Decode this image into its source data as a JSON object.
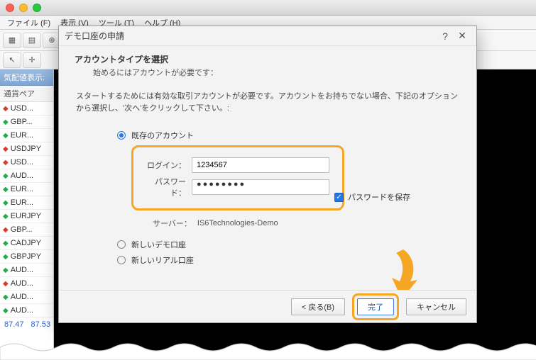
{
  "menus": {
    "file": "ファイル (F)",
    "view": "表示 (V)",
    "tools": "ツール (T)",
    "help": "ヘルプ (H)"
  },
  "sidebar": {
    "header": "気配値表示:",
    "col": "通貨ペア",
    "items": [
      {
        "dir": "dn",
        "sym": "USD..."
      },
      {
        "dir": "up",
        "sym": "GBP..."
      },
      {
        "dir": "up",
        "sym": "EUR..."
      },
      {
        "dir": "dn",
        "sym": "USDJPY"
      },
      {
        "dir": "dn",
        "sym": "USD..."
      },
      {
        "dir": "up",
        "sym": "AUD..."
      },
      {
        "dir": "up",
        "sym": "EUR..."
      },
      {
        "dir": "up",
        "sym": "EUR..."
      },
      {
        "dir": "up",
        "sym": "EURJPY"
      },
      {
        "dir": "dn",
        "sym": "GBP..."
      },
      {
        "dir": "up",
        "sym": "CADJPY"
      },
      {
        "dir": "up",
        "sym": "GBPJPY"
      },
      {
        "dir": "up",
        "sym": "AUD..."
      },
      {
        "dir": "dn",
        "sym": "AUD..."
      },
      {
        "dir": "up",
        "sym": "AUD..."
      },
      {
        "dir": "up",
        "sym": "AUD..."
      }
    ],
    "price1": "87.47",
    "price2": "87.53"
  },
  "dialog": {
    "title": "デモ口座の申請",
    "heading": "アカウントタイプを選択",
    "sub": "始めるにはアカウントが必要です：",
    "desc": "スタートするためには有効な取引アカウントが必要です。アカウントをお持ちでない場合、下記のオプションから選択し、'次へ'をクリックして下さい。:",
    "opt_existing": "既存のアカウント",
    "opt_newdemo": "新しいデモ口座",
    "opt_newreal": "新しいリアル口座",
    "login_label": "ログイン：",
    "login_value": "1234567",
    "pass_label": "パスワード：",
    "pass_value": "●●●●●●●●",
    "save_pw": "パスワードを保存",
    "server_label": "サーバー：",
    "server_value": "IS6Technologies-Demo",
    "back_btn": "< 戻る(B)",
    "finish_btn": "完了",
    "cancel_btn": "キャンセル"
  }
}
